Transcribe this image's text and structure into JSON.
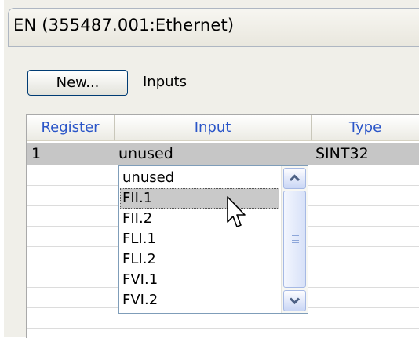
{
  "window": {
    "title": "EN (355487.001:Ethernet)"
  },
  "toolbar": {
    "new_label": "New...",
    "section_label": "Inputs"
  },
  "table": {
    "columns": [
      "Register",
      "Input",
      "Type"
    ],
    "rows": [
      {
        "register": "1",
        "input": "unused",
        "type": "SINT32"
      }
    ]
  },
  "dropdown": {
    "options": [
      "unused",
      "FII.1",
      "FII.2",
      "FLI.1",
      "FLI.2",
      "FVI.1",
      "FVI.2"
    ],
    "highlighted": "FII.1"
  },
  "colors": {
    "header_text": "#2a55c8",
    "selected_row": "#c6c6c6",
    "highlight": "#c9c9c9"
  }
}
